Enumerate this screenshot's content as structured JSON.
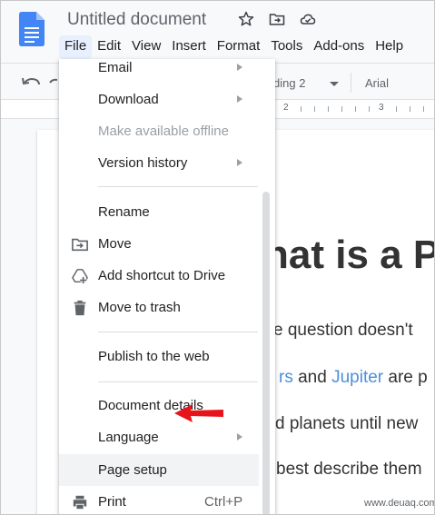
{
  "header": {
    "doc_title": "Untitled document",
    "icons": [
      "star-icon",
      "move-to-folder-icon",
      "cloud-status-icon"
    ]
  },
  "menubar": {
    "items": [
      "File",
      "Edit",
      "View",
      "Insert",
      "Format",
      "Tools",
      "Add-ons",
      "Help"
    ],
    "active": "File"
  },
  "toolbar": {
    "style_value": "ding 2",
    "font_value": "Arial"
  },
  "ruler": {
    "numbers": [
      "2",
      "3"
    ]
  },
  "document": {
    "heading": "hat is a P",
    "line1": "e question doesn't",
    "line2_link1": "rs",
    "line2_mid": " and ",
    "line2_link2": "Jupiter",
    "line2_tail": " are p",
    "line3": "d planets until new",
    "line4": "best describe them"
  },
  "file_menu": {
    "items": {
      "email": "Email",
      "download": "Download",
      "offline": "Make available offline",
      "version_history": "Version history",
      "rename": "Rename",
      "move": "Move",
      "add_shortcut": "Add shortcut to Drive",
      "move_to_trash": "Move to trash",
      "publish": "Publish to the web",
      "details": "Document details",
      "language": "Language",
      "page_setup": "Page setup",
      "print": "Print"
    },
    "print_shortcut": "Ctrl+P"
  },
  "colors": {
    "link": "#4a90d9",
    "arrow": "#e8141b",
    "menu_active_bg": "#e8f0fe",
    "doc_icon": "#4285f4"
  },
  "watermark": "www.deuaq.com"
}
